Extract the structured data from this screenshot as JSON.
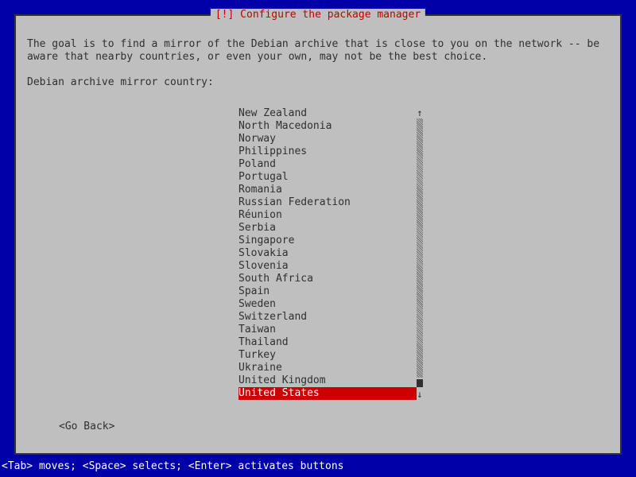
{
  "dialog": {
    "title": "[!] Configure the package manager",
    "intro": "The goal is to find a mirror of the Debian archive that is close to you on the network -- be aware that nearby countries, or even your own, may not be the best choice.",
    "prompt": "Debian archive mirror country:",
    "go_back": "<Go Back>"
  },
  "countries": {
    "items": [
      "New Zealand",
      "North Macedonia",
      "Norway",
      "Philippines",
      "Poland",
      "Portugal",
      "Romania",
      "Russian Federation",
      "Réunion",
      "Serbia",
      "Singapore",
      "Slovakia",
      "Slovenia",
      "South Africa",
      "Spain",
      "Sweden",
      "Switzerland",
      "Taiwan",
      "Thailand",
      "Turkey",
      "Ukraine",
      "United Kingdom",
      "United States"
    ],
    "selected_index": 22
  },
  "footer": {
    "hint": "<Tab> moves; <Space> selects; <Enter> activates buttons"
  }
}
